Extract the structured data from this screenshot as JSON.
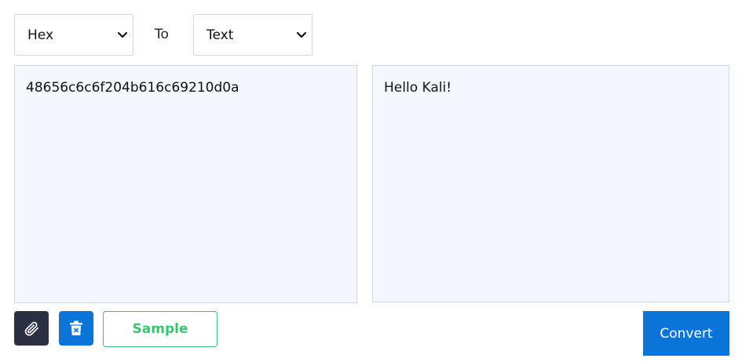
{
  "from_select": {
    "value": "Hex"
  },
  "to_label": "To",
  "to_select": {
    "value": "Text"
  },
  "input_panel": {
    "text": "48656c6c6f204b616c69210d0a"
  },
  "output_panel": {
    "text": "Hello Kali!"
  },
  "actions": {
    "attach_icon": "paperclip-icon",
    "clear_icon": "trash-icon",
    "sample_label": "Sample",
    "convert_label": "Convert"
  },
  "colors": {
    "attach_bg": "#2b3042",
    "clear_bg": "#0a75d8",
    "sample_accent": "#3ac471",
    "convert_bg": "#0a75d8",
    "panel_bg": "#f4f8fc"
  }
}
